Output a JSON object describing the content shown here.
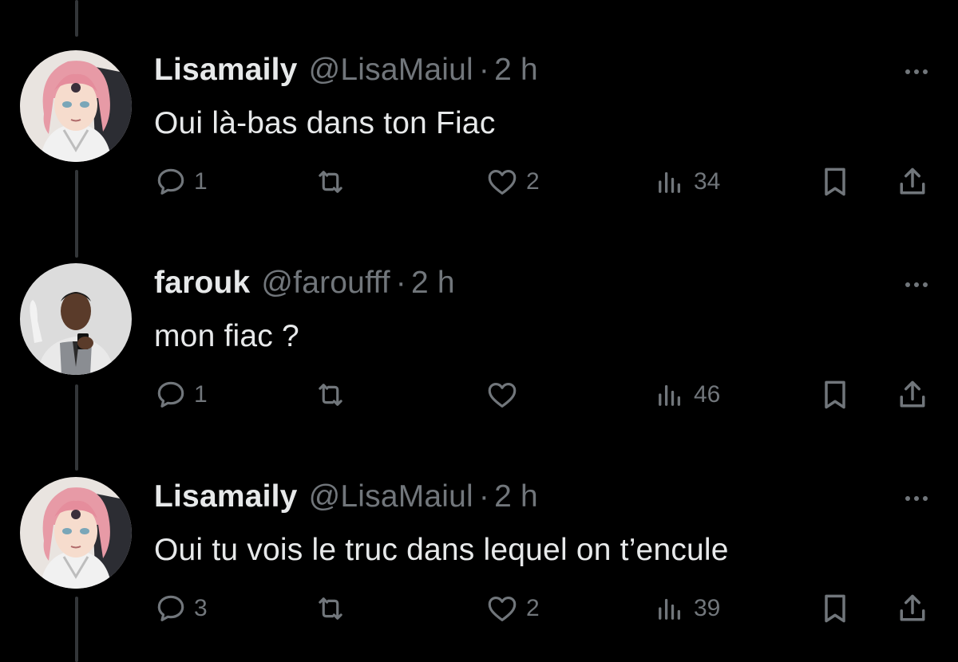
{
  "tweets": [
    {
      "name": "Lisamaily",
      "handle": "@LisaMaiul",
      "sep": "·",
      "time": "2 h",
      "text": "Oui là-bas dans ton Fiac",
      "replies": "1",
      "retweets": "",
      "likes": "2",
      "views": "34"
    },
    {
      "name": "farouk",
      "handle": "@faroufff",
      "sep": "·",
      "time": "2 h",
      "text": "mon fiac ?",
      "replies": "1",
      "retweets": "",
      "likes": "",
      "views": "46"
    },
    {
      "name": "Lisamaily",
      "handle": "@LisaMaiul",
      "sep": "·",
      "time": "2 h",
      "text": "Oui tu vois le truc dans lequel on t’encule",
      "replies": "3",
      "retweets": "",
      "likes": "2",
      "views": "39"
    }
  ],
  "icons": {
    "reply": "speech-bubble-icon",
    "retweet": "retweet-arrows-icon",
    "like": "heart-icon",
    "views": "bar-chart-icon",
    "bookmark": "bookmark-icon",
    "share": "share-upload-icon",
    "more": "more-dots-icon"
  },
  "colors": {
    "background": "#000000",
    "primary_text": "#e7e9ea",
    "secondary_text": "#71767b",
    "thread_line": "#333639"
  }
}
